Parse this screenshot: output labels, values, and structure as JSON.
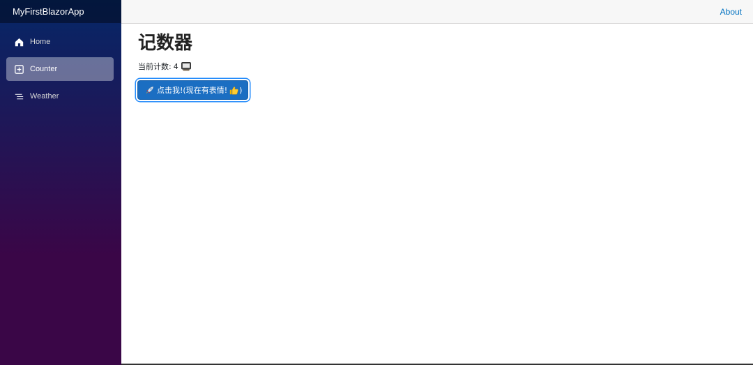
{
  "app": {
    "brand": "MyFirstBlazorApp"
  },
  "topbar": {
    "about": "About"
  },
  "sidebar": {
    "items": [
      {
        "label": "Home",
        "icon": "house-icon",
        "active": false
      },
      {
        "label": "Counter",
        "icon": "plus-square-icon",
        "active": true
      },
      {
        "label": "Weather",
        "icon": "list-icon",
        "active": false
      }
    ]
  },
  "main": {
    "title": "记数器",
    "count_label": "当前计数:",
    "count_value": "4",
    "count_icon": "monitor-icon",
    "button": {
      "icon": "rocket-icon",
      "text": "点击我!(现在有表情!",
      "thumb_icon": "thumbs-up-icon",
      "close": ")"
    }
  },
  "colors": {
    "sidebar_top": "#052767",
    "sidebar_bottom": "#3a0647",
    "button": "#1b6ec2",
    "link": "#0071c1"
  }
}
